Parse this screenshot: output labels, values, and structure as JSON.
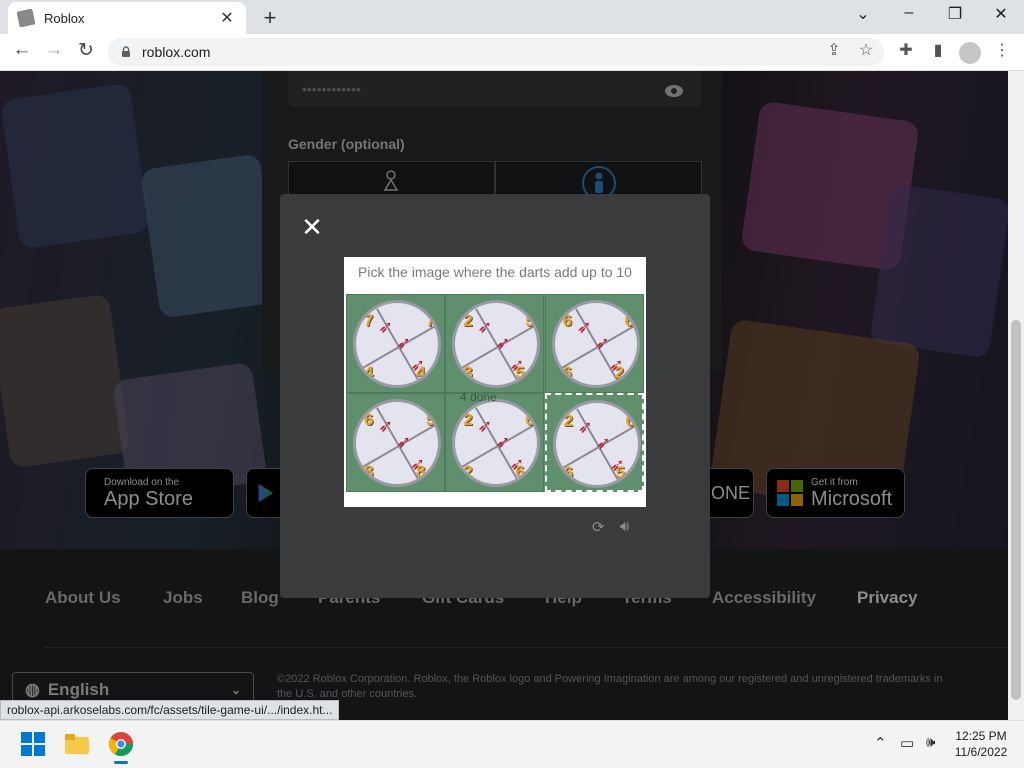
{
  "browser": {
    "tab_title": "Roblox",
    "url": "roblox.com",
    "status_url": "roblox-api.arkoselabs.com/fc/assets/tile-game-ui/.../index.ht..."
  },
  "signup": {
    "password_mask": "••••••••••••",
    "gender_label": "Gender (optional)"
  },
  "stores": {
    "apple_small": "Download on the",
    "apple_big": "App Store",
    "xbox_partial": "ONE",
    "microsoft_small": "Get it from",
    "microsoft_big": "Microsoft"
  },
  "footer": {
    "links": [
      "About Us",
      "Jobs",
      "Blog",
      "Parents",
      "Gift Cards",
      "Help",
      "Terms",
      "Accessibility",
      "Privacy"
    ],
    "language": "English",
    "copyright": "©2022 Roblox Corporation. Roblox, the Roblox logo and Powering Imagination are among our registered and unregistered trademarks in the U.S. and other countries."
  },
  "captcha": {
    "prompt": "Pick the image where the darts add up to 10",
    "progress_text": "4 done",
    "tiles": [
      {
        "numbers": [
          "7",
          "4",
          "7",
          "4"
        ],
        "selected": false
      },
      {
        "numbers": [
          "2",
          "5",
          "5",
          "3"
        ],
        "selected": false
      },
      {
        "numbers": [
          "6",
          "2",
          "6",
          "6"
        ],
        "selected": false
      },
      {
        "numbers": [
          "6",
          "8",
          "5",
          "8"
        ],
        "selected": false
      },
      {
        "numbers": [
          "2",
          "6",
          "6",
          "2"
        ],
        "selected": false
      },
      {
        "numbers": [
          "2",
          "5",
          "6",
          "6"
        ],
        "selected": true
      }
    ]
  },
  "taskbar": {
    "time": "12:25 PM",
    "date": "11/6/2022"
  }
}
